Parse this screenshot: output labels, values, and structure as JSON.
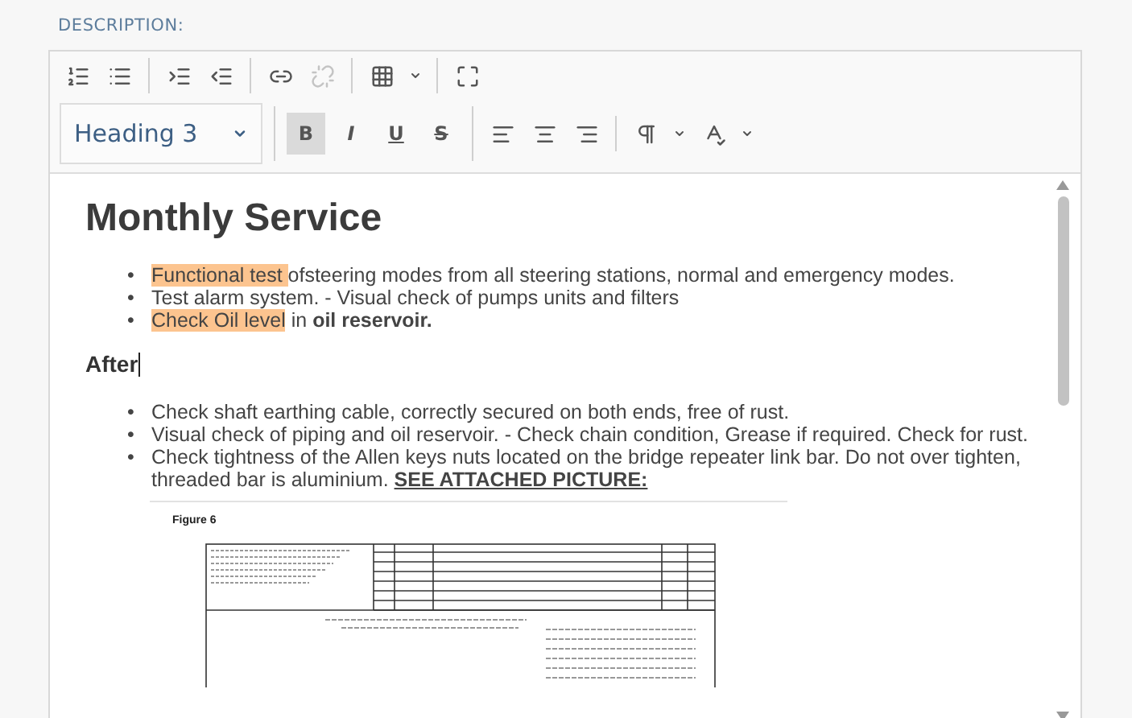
{
  "label": "DESCRIPTION:",
  "toolbar": {
    "row_1": [
      [
        {
          "kind": "ordered-list",
          "disabled": false
        },
        {
          "kind": "bullet-list",
          "disabled": false
        }
      ],
      [
        {
          "kind": "indent",
          "disabled": false
        },
        {
          "kind": "outdent",
          "disabled": false
        }
      ],
      [
        {
          "kind": "link",
          "disabled": false
        },
        {
          "kind": "unlink",
          "disabled": true
        }
      ],
      [
        {
          "kind": "table",
          "disabled": false
        },
        {
          "kind": "caret",
          "disabled": false
        }
      ],
      [
        {
          "kind": "maximize",
          "disabled": false
        }
      ]
    ],
    "format_select": {
      "value": "Heading 3"
    },
    "style_buttons": [
      {
        "kind": "bold",
        "label": "B",
        "selected": true
      },
      {
        "kind": "italic",
        "label": "I",
        "selected": false
      },
      {
        "kind": "underline",
        "label": "U",
        "selected": false
      },
      {
        "kind": "strike",
        "label": "S",
        "selected": false
      }
    ],
    "row_2_icons": [
      [
        {
          "kind": "align-left",
          "disabled": false
        },
        {
          "kind": "align-center",
          "disabled": false
        },
        {
          "kind": "align-right",
          "disabled": false
        }
      ],
      [
        {
          "kind": "paragraph",
          "disabled": false
        },
        {
          "kind": "caret",
          "disabled": false
        },
        {
          "kind": "spell",
          "disabled": false
        },
        {
          "kind": "caret",
          "disabled": false
        }
      ]
    ]
  },
  "content": [
    {
      "kind": "heading",
      "text": "Monthly Service",
      "cursor": false
    },
    {
      "kind": "list",
      "items": [
        {
          "bullet": "•",
          "segments": [
            {
              "text": "Functional test ",
              "highlighted": true,
              "bold": false,
              "underlined": false
            },
            {
              "text": "ofsteering modes from all steering stations, normal and emergency modes.",
              "highlighted": false,
              "bold": false,
              "underlined": false
            }
          ]
        },
        {
          "bullet": "•",
          "segments": [
            {
              "text": "Test alarm system. - Visual check of pumps units and filters",
              "highlighted": false,
              "bold": false,
              "underlined": false
            }
          ]
        },
        {
          "bullet": "•",
          "segments": [
            {
              "text": "Check Oil level",
              "highlighted": true,
              "bold": false,
              "underlined": false
            },
            {
              "text": " in ",
              "highlighted": false,
              "bold": false,
              "underlined": false
            },
            {
              "text": "oil reservoir.",
              "highlighted": false,
              "bold": true,
              "underlined": false
            }
          ]
        }
      ]
    },
    {
      "kind": "subheading",
      "text": "After",
      "cursor": true
    },
    {
      "kind": "list",
      "items": [
        {
          "bullet": "•",
          "segments": [
            {
              "text": "Check shaft earthing cable, correctly secured on both ends, free of rust.",
              "highlighted": false,
              "bold": false,
              "underlined": false
            }
          ]
        },
        {
          "bullet": "•",
          "segments": [
            {
              "text": "Visual check of piping and oil reservoir. - Check chain condition, Grease if required. Check for rust.",
              "highlighted": false,
              "bold": false,
              "underlined": false
            }
          ]
        },
        {
          "bullet": "•",
          "segments": [
            {
              "text": "Check tightness of the Allen keys nuts located on the bridge repeater link bar. Do not over tighten, threaded bar is aluminium. ",
              "highlighted": false,
              "bold": false,
              "underlined": false
            },
            {
              "text": "SEE ATTACHED PICTURE:",
              "highlighted": false,
              "bold": true,
              "underlined": true
            }
          ]
        }
      ]
    },
    {
      "kind": "figure",
      "caption": "Figure 6"
    }
  ]
}
